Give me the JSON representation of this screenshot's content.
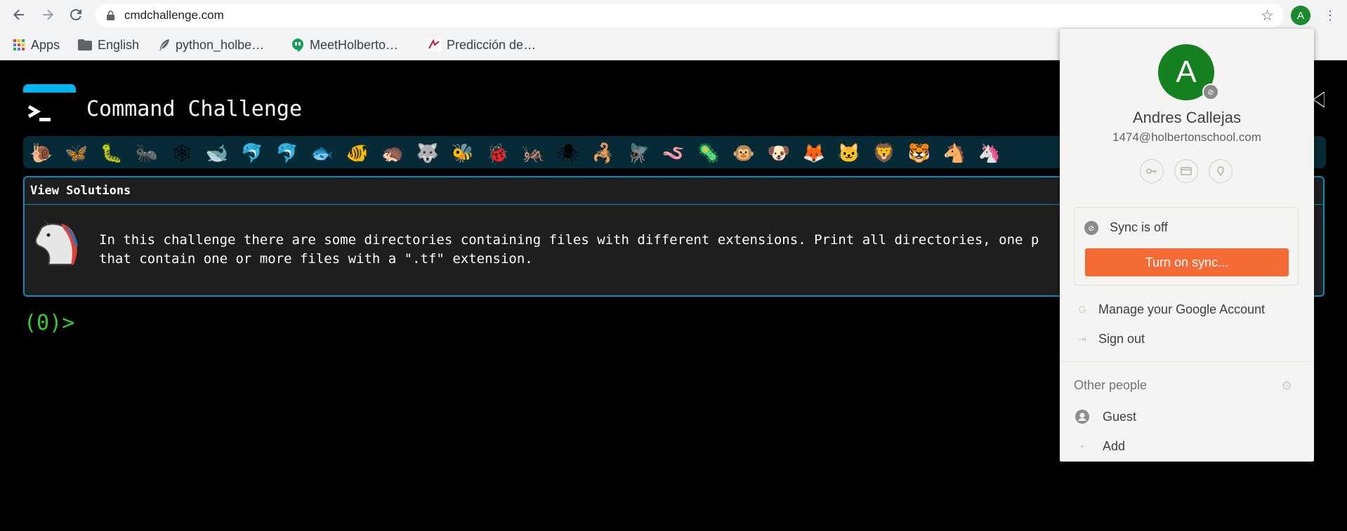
{
  "browser": {
    "url": "cmdchallenge.com",
    "profile_initial": "A",
    "bookmarks": [
      {
        "label": "Apps",
        "icon": "apps-grid-icon"
      },
      {
        "label": "English",
        "icon": "folder-icon"
      },
      {
        "label": "python_holbe…",
        "icon": "feather-icon"
      },
      {
        "label": "MeetHolberto…",
        "icon": "hangouts-icon"
      },
      {
        "label": "Predicción de…",
        "icon": "site-icon"
      }
    ]
  },
  "page": {
    "title": "Command Challenge",
    "panel_header": "View Solutions",
    "challenge_line1": "In this challenge there are some directories containing files with different extensions. Print all directories, one p",
    "challenge_line2": "that contain one or more files with a \".tf\" extension.",
    "prompt": "(0)>",
    "badges": [
      "🐌",
      "🦋",
      "🐛",
      "🐜",
      "🕸",
      "🐋",
      "🐬",
      "🐬",
      "🐟",
      "🐠",
      "🦔",
      "🐺",
      "🐝",
      "🐞",
      "🦗",
      "🕷",
      "🦂",
      "🪰",
      "🪱",
      "🦠",
      "🐵",
      "🐶",
      "🦊",
      "🐱",
      "🦁",
      "🐯",
      "🐴",
      "🦄"
    ]
  },
  "profile": {
    "initial": "A",
    "name": "Andres Callejas",
    "email": "1474@holbertonschool.com",
    "sync_status": "Sync is off",
    "sync_button": "Turn on sync...",
    "manage_account": "Manage your Google Account",
    "sign_out": "Sign out",
    "other_people": "Other people",
    "guest": "Guest",
    "add": "Add"
  },
  "colors": {
    "accent_blue": "#00b4f0",
    "prompt_green": "#33cc33",
    "sync_orange": "#f46b36",
    "avatar_green": "#14801f"
  }
}
